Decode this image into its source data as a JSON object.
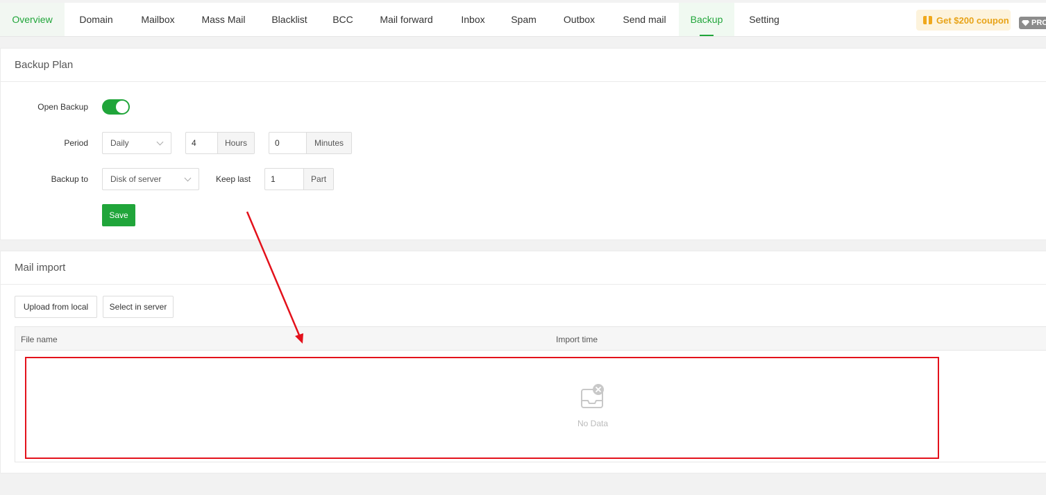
{
  "tabs": [
    {
      "label": "Overview",
      "active": true
    },
    {
      "label": "Domain"
    },
    {
      "label": "Mailbox"
    },
    {
      "label": "Mass Mail"
    },
    {
      "label": "Blacklist"
    },
    {
      "label": "BCC"
    },
    {
      "label": "Mail forward"
    },
    {
      "label": "Inbox"
    },
    {
      "label": "Spam"
    },
    {
      "label": "Outbox"
    },
    {
      "label": "Send mail"
    },
    {
      "label": "Backup",
      "active": true
    },
    {
      "label": "Setting"
    }
  ],
  "coupon_label": "Get $200 coupon",
  "pro_badge": "PRO",
  "backup_plan": {
    "title": "Backup Plan",
    "open_backup_label": "Open Backup",
    "open_backup_on": true,
    "period_label": "Period",
    "period_value": "Daily",
    "hours_value": "4",
    "hours_unit": "Hours",
    "minutes_value": "0",
    "minutes_unit": "Minutes",
    "backup_to_label": "Backup to",
    "backup_to_value": "Disk of server",
    "keep_last_label": "Keep last",
    "keep_last_value": "1",
    "keep_last_unit": "Part",
    "save_label": "Save"
  },
  "mail_import": {
    "title": "Mail import",
    "upload_label": "Upload from local",
    "select_label": "Select in server",
    "columns": [
      "File name",
      "Import time"
    ],
    "empty_text": "No Data"
  },
  "colors": {
    "accent": "#20a53a",
    "annotation": "#e3111b",
    "coupon": "#e8a317"
  }
}
